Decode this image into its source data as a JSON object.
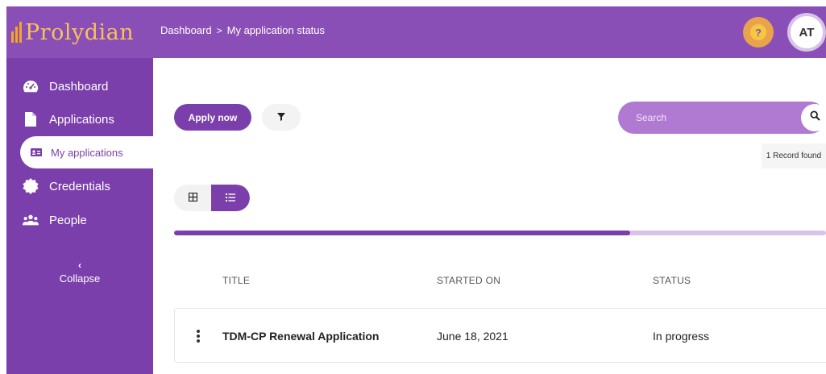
{
  "brand": {
    "name": "Prolydian",
    "accent": "#8a4fb6",
    "logo_color": "#f5a623"
  },
  "header": {
    "breadcrumb": [
      "Dashboard",
      "My application status"
    ],
    "breadcrumb_separator": ">",
    "help_icon": "question-icon",
    "user_initials": "AT"
  },
  "sidebar": {
    "items": [
      {
        "label": "Dashboard",
        "icon": "speedometer-icon"
      },
      {
        "label": "Applications",
        "icon": "document-icon"
      },
      {
        "label": "My applications",
        "icon": "id-card-icon",
        "active": true
      },
      {
        "label": "Credentials",
        "icon": "certificate-badge-icon"
      },
      {
        "label": "People",
        "icon": "people-icon"
      }
    ],
    "collapse_label": "Collapse"
  },
  "toolbar": {
    "apply_label": "Apply now",
    "filter_icon": "filter-icon",
    "search_placeholder": "Search",
    "search_value": "",
    "record_count": "1 Record found"
  },
  "view_toggle": {
    "options": [
      "grid",
      "list"
    ],
    "selected": "list"
  },
  "progress": {
    "fraction": 0.7
  },
  "table": {
    "columns": [
      "TITLE",
      "STARTED ON",
      "STATUS"
    ],
    "rows": [
      {
        "title": "TDM-CP Renewal Application",
        "started_on": "June 18, 2021",
        "status": "In progress"
      }
    ]
  }
}
